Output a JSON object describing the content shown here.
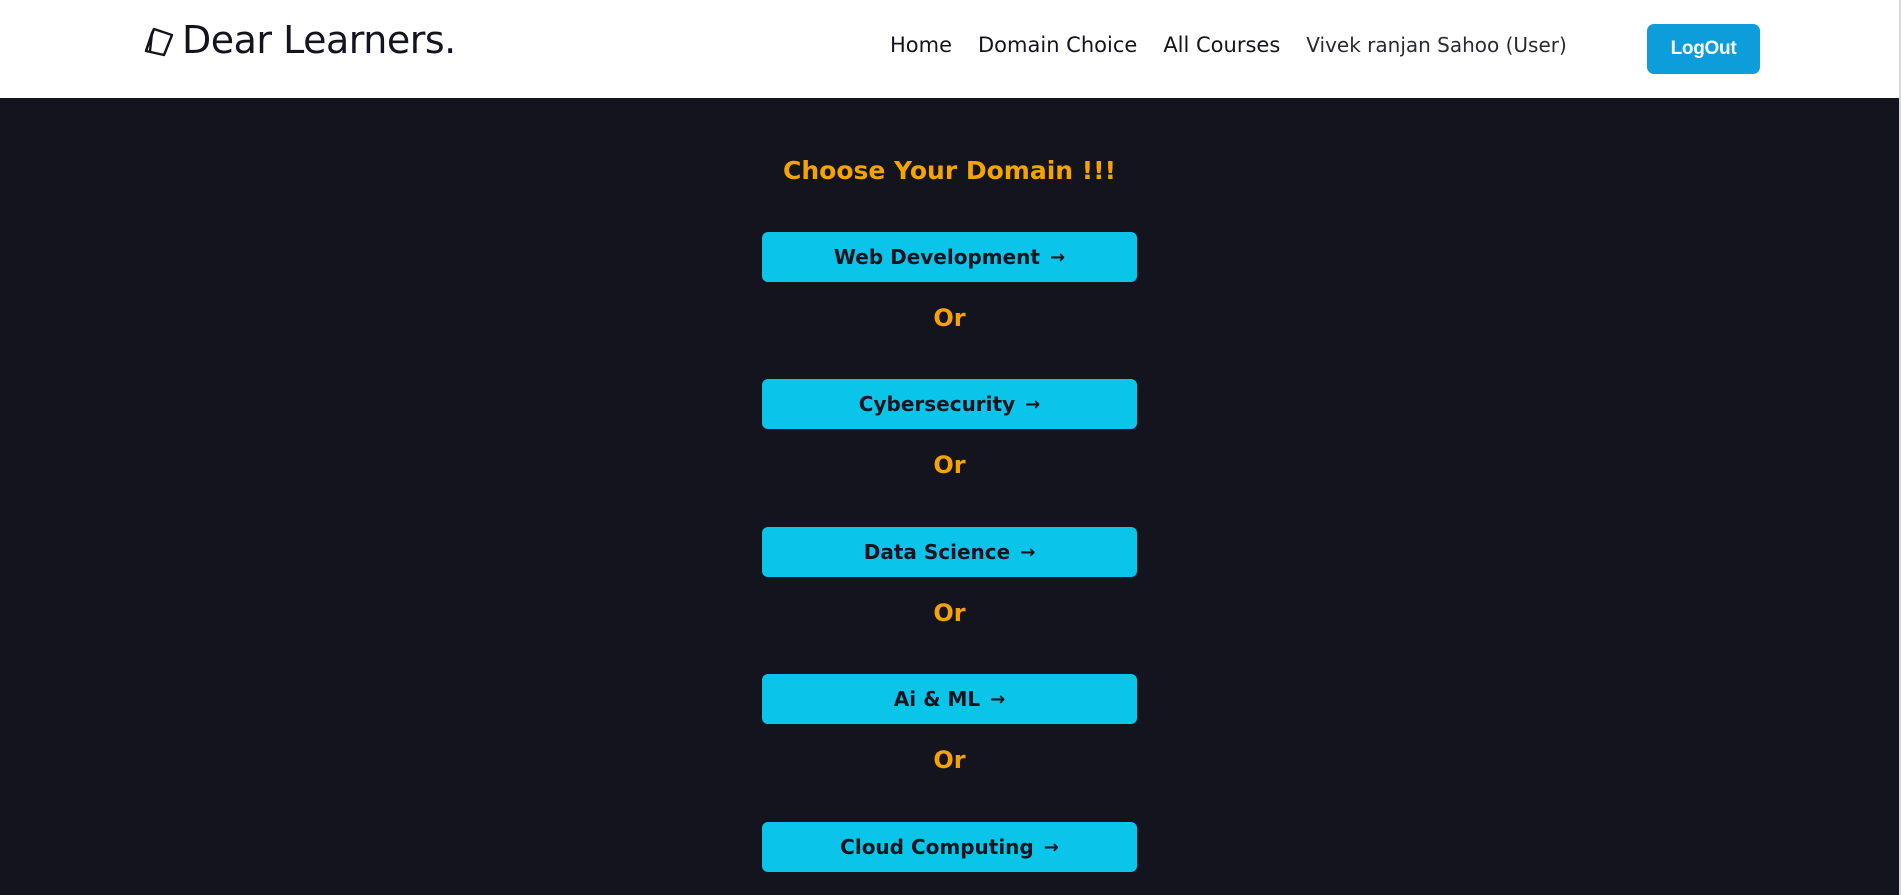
{
  "header": {
    "brand": "Dear Learners.",
    "brand_icon": "book-icon",
    "nav": {
      "home": "Home",
      "domain_choice": "Domain Choice",
      "all_courses": "All Courses",
      "user": "Vivek ranjan Sahoo (User)"
    },
    "logout_label": "LogOut"
  },
  "main": {
    "title": "Choose Your Domain !!!",
    "separator": "Or",
    "domains": [
      {
        "label": "Web Development",
        "arrow": "→"
      },
      {
        "label": "Cybersecurity",
        "arrow": "→"
      },
      {
        "label": "Data Science",
        "arrow": "→"
      },
      {
        "label": "Ai & ML",
        "arrow": "→"
      },
      {
        "label": "Cloud Computing",
        "arrow": "→"
      }
    ]
  },
  "colors": {
    "background": "#14141f",
    "accent": "#f5a300",
    "button": "#0bc4ea",
    "logout": "#0d9ddb"
  }
}
